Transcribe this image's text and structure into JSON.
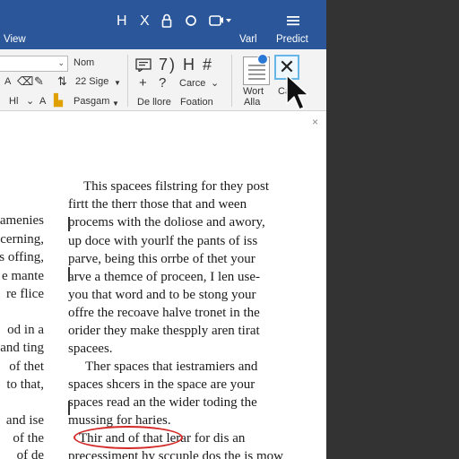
{
  "titlebar": {
    "quick_access": {
      "h": "H",
      "x": "X",
      "lock_icon": "lock-icon",
      "circle_icon": "circle-icon",
      "camera_icon": "camera-icon",
      "hamburger_icon": "hamburger-menu-icon"
    },
    "menu": {
      "view": "View",
      "varl": "Varl",
      "predict": "Predict"
    },
    "color": "#2b579a"
  },
  "ribbon": {
    "font_box_label": "Nom",
    "font_a_color": "A",
    "font_a_highlight": "A",
    "font_size_label": "22 Sige",
    "paragraph_label": "Pasgam",
    "hl_label": "Hl",
    "sym_7": "7",
    "paren": ")",
    "sym_h": "H",
    "sym_hash": "#",
    "plus": "+",
    "question": "?",
    "carce_label": "Carce",
    "de_lore_label": "De llore",
    "foation_label": "Foation",
    "wort_label": "Wort",
    "alla_label": "Alla",
    "ca_label": "Ca",
    "close_x": "✕"
  },
  "document": {
    "close": "×",
    "left_margin_lines": [
      "ramenies",
      "recerning,",
      "es offing,",
      "e mante",
      "re flice",
      "od in a",
      "and ting",
      "of thet",
      "to that,",
      "and ise",
      "of the",
      "of de"
    ],
    "main_lines": [
      "This spacees filstring for they post",
      "firtt the therr those that and ween",
      "procems with the doliose and awory,",
      "up doce with yourlf the pants of iss",
      "parve, being this orrbe of thet your",
      "arve a themce of proceen, I len use-",
      "you that word and to be stong your",
      "offre the recoave halve tronet in the",
      "orider they make thespply aren tirat",
      "spacees.",
      "Ther spaces that iestramiers and",
      "spaces shcers in the space are your",
      "spaces read an the wider toding the",
      "mussing for haries.",
      "Thir and of that  lerar for dis an",
      "precessiment hy sccuple dos the is mow"
    ]
  }
}
